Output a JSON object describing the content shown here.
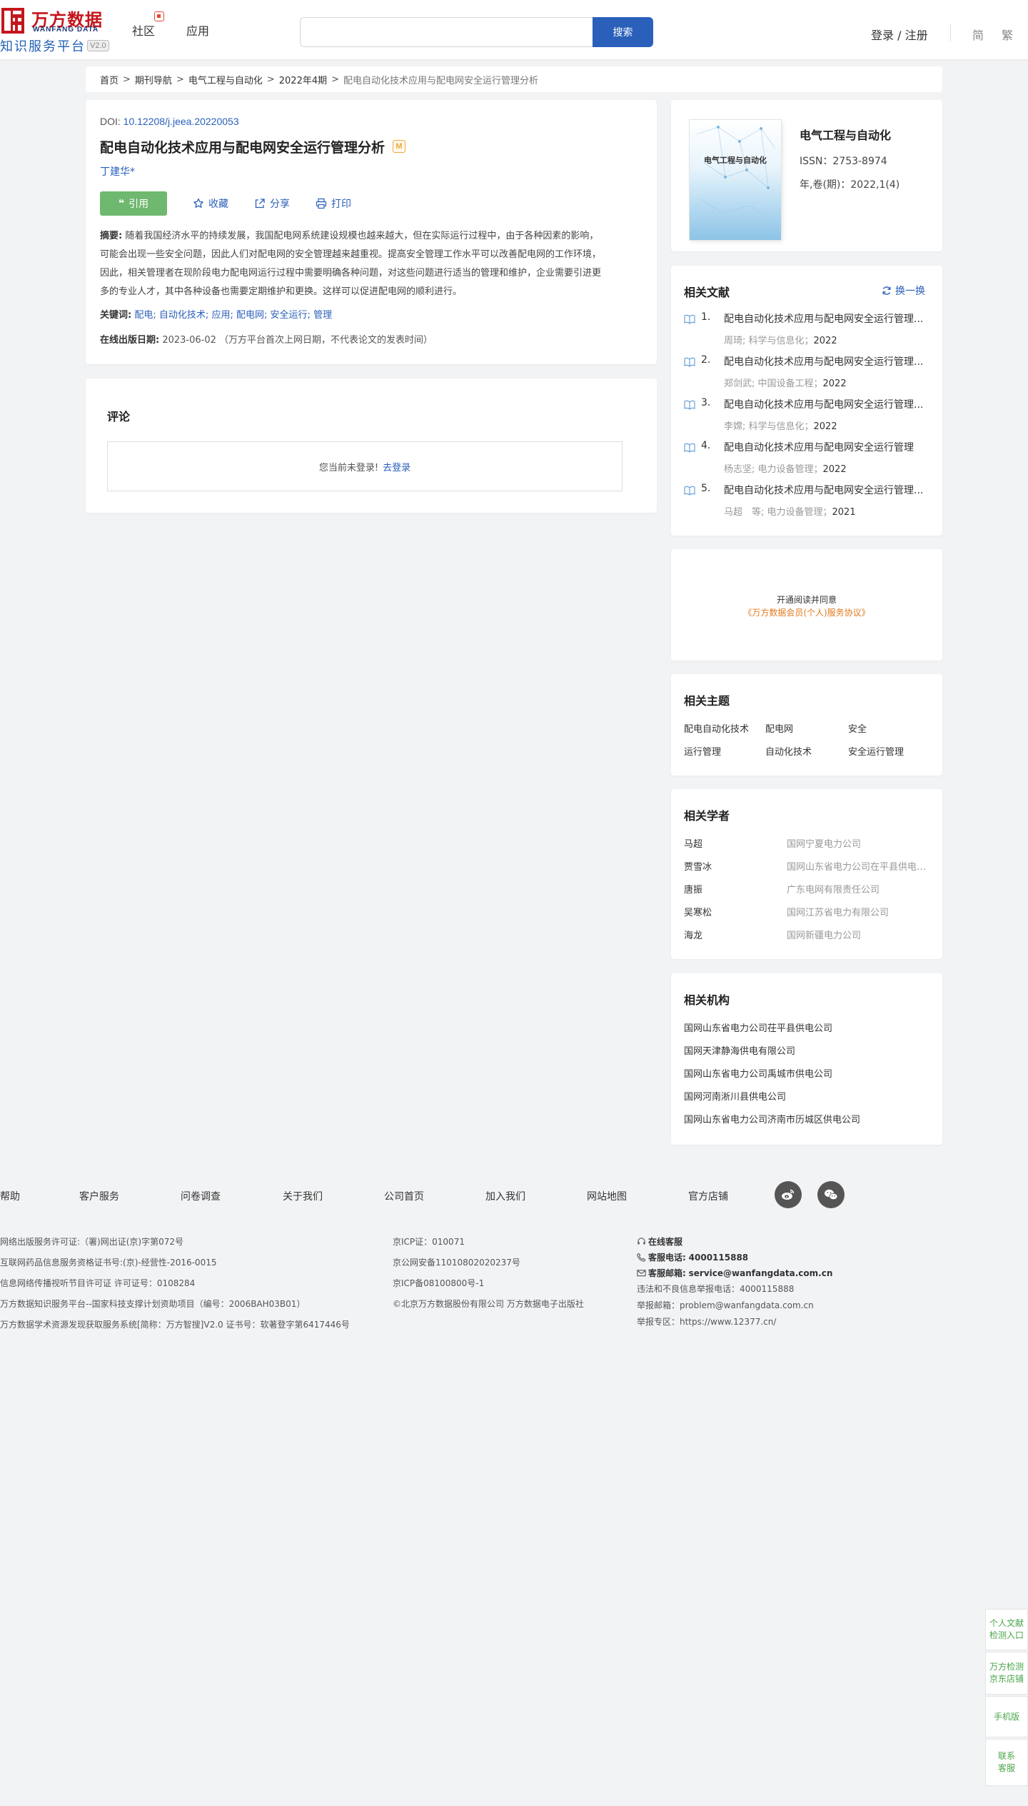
{
  "header": {
    "logo_cn": "万方数据",
    "logo_en": "WANFANG DATA",
    "logo_sub": "知识服务平台",
    "logo_ver": "V2.0",
    "nav_community": "社区",
    "nav_apps": "应用",
    "search_value": "",
    "search_button": "搜索",
    "login": "登录 / 注册",
    "lang_simp": "简",
    "lang_trad": "繁"
  },
  "breadcrumb": {
    "items": [
      "首页",
      "期刊导航",
      "电气工程与自动化",
      "2022年4期"
    ],
    "current": "配电自动化技术应用与配电网安全运行管理分析",
    "sep": ">"
  },
  "article": {
    "doi_label": "DOI:",
    "doi": "10.12208/j.jeea.20220053",
    "title": "配电自动化技术应用与配电网安全运行管理分析",
    "m_badge": "M",
    "author": "丁建华*",
    "cite": "引用",
    "favorite": "收藏",
    "share": "分享",
    "print": "打印",
    "abstract_label": "摘要:",
    "abstract_lines": [
      "随着我国经济水平的持续发展，我国配电网系统建设规模也越来越大，但在实际运行过程中，由于各种因素的影响，",
      "可能会出现一些安全问题，因此人们对配电网的安全管理越来越重视。提高安全管理工作水平可以改善配电网的工作环境，",
      "因此，相关管理者在现阶段电力配电网运行过程中需要明确各种问题，对这些问题进行适当的管理和维护，企业需要引进更",
      "多的专业人才，其中各种设备也需要定期维护和更换。这样可以促进配电网的顺利进行。"
    ],
    "keywords_label": "关键词:",
    "keywords": [
      "配电",
      "自动化技术",
      "应用",
      "配电网",
      "安全运行",
      "管理"
    ],
    "keyword_sep": ";",
    "pubdate_label": "在线出版日期:",
    "pubdate": "2023-06-02",
    "pubdate_note": "（万方平台首次上网日期，不代表论文的发表时间）"
  },
  "comments": {
    "title": "评论",
    "not_logged": "您当前未登录!",
    "go_login": "去登录"
  },
  "journal": {
    "cover_title": "电气工程与自动化",
    "name": "电气工程与自动化",
    "issn": "ISSN：2753-8974",
    "vol": "年,卷(期)：2022,1(4)"
  },
  "related_docs": {
    "title": "相关文献",
    "swap": "换一换",
    "items": [
      {
        "num": "1.",
        "title": "配电自动化技术应用与配电网安全运行管理...",
        "meta": "周琦; 科学与信息化；",
        "year": "2022"
      },
      {
        "num": "2.",
        "title": "配电自动化技术应用与配电网安全运行管理...",
        "meta": "郑剑武; 中国设备工程；",
        "year": "2022"
      },
      {
        "num": "3.",
        "title": "配电自动化技术应用与配电网安全运行管理...",
        "meta": "李嫦; 科学与信息化；",
        "year": "2022"
      },
      {
        "num": "4.",
        "title": "配电自动化技术应用与配电网安全运行管理",
        "meta": "杨志坚; 电力设备管理；",
        "year": "2022"
      },
      {
        "num": "5.",
        "title": "配电自动化技术应用与配电网安全运行管理...",
        "meta": "马超　等; 电力设备管理；",
        "year": "2021"
      }
    ]
  },
  "open_read": {
    "line1": "开通阅读并同意",
    "line2": "《万方数据会员(个人)服务协议》"
  },
  "topics": {
    "title": "相关主题",
    "items": [
      "配电自动化技术",
      "配电网",
      "安全",
      "运行管理",
      "自动化技术",
      "安全运行管理"
    ]
  },
  "scholars": {
    "title": "相关学者",
    "items": [
      {
        "name": "马超",
        "org": "国网宁夏电力公司"
      },
      {
        "name": "贾雪冰",
        "org": "国网山东省电力公司在平县供电公司"
      },
      {
        "name": "唐振",
        "org": "广东电网有限责任公司"
      },
      {
        "name": "吴寒松",
        "org": "国网江苏省电力有限公司"
      },
      {
        "name": "海龙",
        "org": "国网新疆电力公司"
      }
    ]
  },
  "orgs": {
    "title": "相关机构",
    "items": [
      "国网山东省电力公司茌平县供电公司",
      "国网天津静海供电有限公司",
      "国网山东省电力公司禹城市供电公司",
      "国网河南淅川县供电公司",
      "国网山东省电力公司济南市历城区供电公司"
    ]
  },
  "footer": {
    "links": [
      "帮助",
      "客户服务",
      "问卷调查",
      "关于我们",
      "公司首页",
      "加入我们",
      "网站地图",
      "官方店铺"
    ],
    "col1": [
      "网络出版服务许可证:（署)网出证(京)字第072号",
      "互联网药品信息服务资格证书号:(京)-经营性-2016-0015",
      "信息网络传播视听节目许可证 许可证号：0108284",
      "万方数据知识服务平台--国家科技支撑计划资助项目（编号：2006BAH03B01）",
      "万方数据学术资源发现获取服务系统[简称：万方智搜]V2.0 证书号：软著登字第6417446号"
    ],
    "col2": [
      "京ICP证：010071",
      "京公网安备11010802020237号",
      "京ICP备08100800号-1",
      "©北京万方数据股份有限公司 万方数据电子出版社"
    ],
    "online_service": "在线客服",
    "phone_label": "客服电话:",
    "phone": "4000115888",
    "email_label": "客服邮箱:",
    "email": "service@wanfangdata.com.cn",
    "report_phone": "违法和不良信息举报电话：4000115888",
    "report_email": "举报邮箱：problem@wanfangdata.com.cn",
    "report_area": "举报专区：https://www.12377.cn/"
  },
  "side": {
    "personal": [
      "个人文献",
      "检测入口"
    ],
    "jd": [
      "万方检测",
      "京东店铺"
    ],
    "mobile": "手机版",
    "contact": [
      "联系",
      "客服"
    ]
  },
  "colors": {
    "brand_red": "#c4161c",
    "brand_blue": "#2a5fba",
    "cite_green": "#6fb86f",
    "agreement_orange": "#e07b1f",
    "side_green": "#4aa54a"
  }
}
